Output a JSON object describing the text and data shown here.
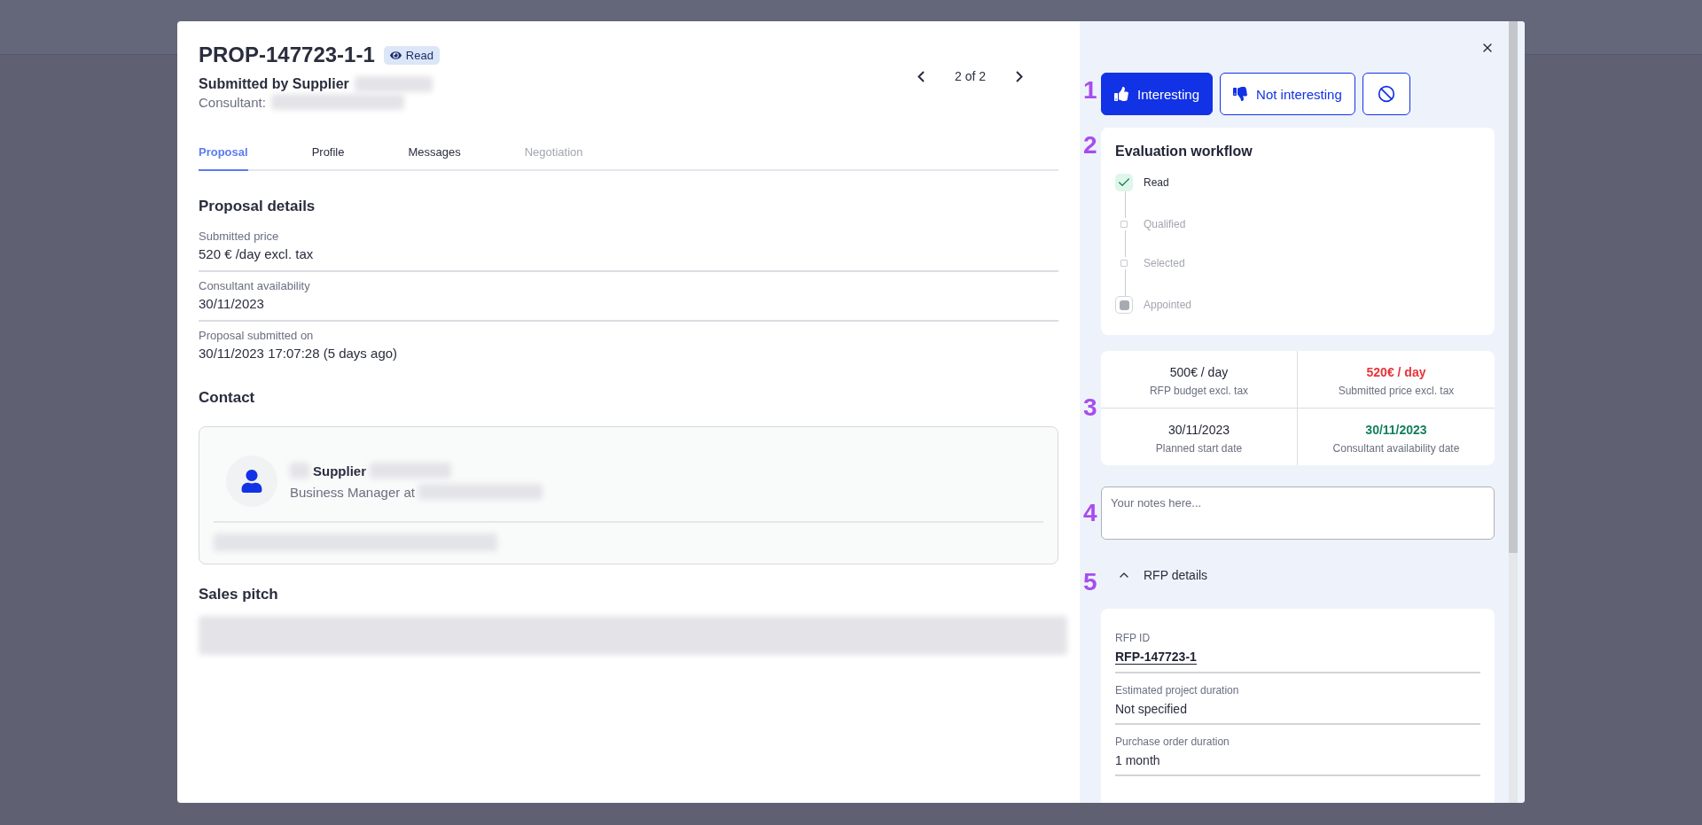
{
  "header": {
    "title": "PROP-147723-1-1",
    "status_badge": "Read",
    "submitted_by": "Submitted by Supplier",
    "consultant_label": "Consultant:",
    "pager": "2 of 2"
  },
  "tabs": [
    {
      "label": "Proposal",
      "selected": true,
      "disabled": false
    },
    {
      "label": "Profile",
      "selected": false,
      "disabled": false
    },
    {
      "label": "Messages",
      "selected": false,
      "disabled": false
    },
    {
      "label": "Negotiation",
      "selected": false,
      "disabled": true
    }
  ],
  "proposal_details": {
    "heading": "Proposal details",
    "fields": [
      {
        "label": "Submitted price",
        "value": "520 € /day excl. tax"
      },
      {
        "label": "Consultant availability",
        "value": "30/11/2023"
      },
      {
        "label": "Proposal submitted on",
        "value": "30/11/2023 17:07:28 (5 days ago)"
      }
    ]
  },
  "contact": {
    "heading": "Contact",
    "name": "Supplier",
    "role": "Business Manager at"
  },
  "sales_pitch": {
    "heading": "Sales pitch"
  },
  "actions": {
    "marker": "1",
    "buttons": [
      {
        "kind": "like",
        "label": "Interesting",
        "selected": true
      },
      {
        "kind": "dislike",
        "label": "Not interesting",
        "selected": false
      },
      {
        "kind": "block",
        "selected": false
      }
    ]
  },
  "workflow": {
    "marker": "2",
    "title": "Evaluation workflow",
    "steps": [
      {
        "kind": "check",
        "label": "Read",
        "done": true
      },
      {
        "kind": "small",
        "label": "Qualified",
        "done": false
      },
      {
        "kind": "small",
        "label": "Selected",
        "done": false
      },
      {
        "kind": "final",
        "label": "Appointed",
        "done": false
      }
    ]
  },
  "summary": {
    "marker": "3",
    "cells": [
      {
        "value": "500€ / day",
        "label": "RFP budget excl. tax",
        "color": "#1f2233"
      },
      {
        "value": "520€ / day",
        "label": "Submitted price excl. tax",
        "color": "#e8333a"
      },
      {
        "value": "30/11/2023",
        "label": "Planned start date",
        "color": "#1f2233"
      },
      {
        "value": "30/11/2023",
        "label": "Consultant availability date",
        "color": "#13805a"
      }
    ]
  },
  "notes": {
    "marker": "4",
    "placeholder": "Your notes here..."
  },
  "rfp_details": {
    "marker": "5",
    "title": "RFP details",
    "expanded": true,
    "fields": [
      {
        "kind": "link",
        "label": "RFP ID",
        "value": "RFP-147723-1"
      },
      {
        "kind": "text",
        "label": "Estimated project duration",
        "value": "Not specified"
      },
      {
        "kind": "text",
        "label": "Purchase order duration",
        "value": "1 month"
      }
    ]
  }
}
